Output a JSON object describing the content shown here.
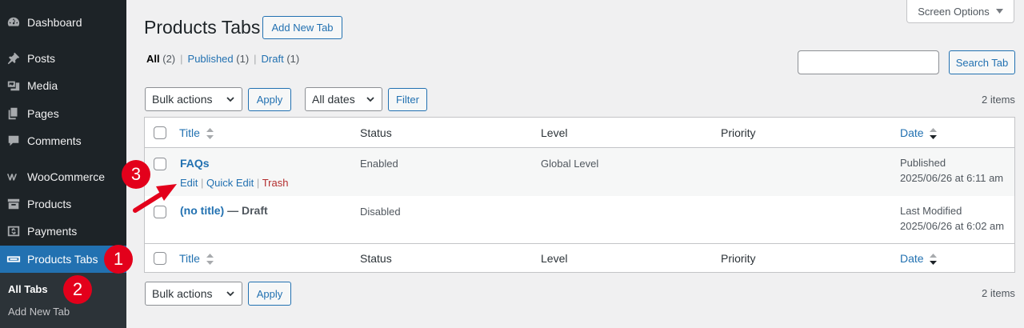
{
  "sidebar": {
    "items": [
      {
        "label": "Dashboard",
        "icon": "dashboard-icon"
      },
      {
        "label": "Posts",
        "icon": "pin-icon"
      },
      {
        "label": "Media",
        "icon": "media-icon"
      },
      {
        "label": "Pages",
        "icon": "pages-icon"
      },
      {
        "label": "Comments",
        "icon": "comments-icon"
      },
      {
        "label": "WooCommerce",
        "icon": "woocommerce-icon"
      },
      {
        "label": "Products",
        "icon": "archive-icon"
      },
      {
        "label": "Payments",
        "icon": "dollar-icon"
      },
      {
        "label": "Products Tabs",
        "icon": "tabs-icon"
      }
    ],
    "submenu": [
      {
        "label": "All Tabs"
      },
      {
        "label": "Add New Tab"
      }
    ]
  },
  "header": {
    "title": "Products Tabs",
    "add_new_label": "Add New Tab",
    "screen_options_label": "Screen Options"
  },
  "views": {
    "all_label": "All",
    "all_count": "(2)",
    "published_label": "Published",
    "published_count": "(1)",
    "draft_label": "Draft",
    "draft_count": "(1)",
    "separator": "|"
  },
  "search": {
    "value": "",
    "button_label": "Search Tab"
  },
  "toolbar": {
    "bulk_actions": "Bulk actions",
    "apply": "Apply",
    "dates": "All dates",
    "filter": "Filter",
    "items_count": "2 items"
  },
  "table": {
    "columns": {
      "title": "Title",
      "status": "Status",
      "level": "Level",
      "priority": "Priority",
      "date": "Date"
    },
    "rows": [
      {
        "title": "FAQs",
        "status": "Enabled",
        "level": "Global Level",
        "priority": "",
        "date_state": "Published",
        "date_value": "2025/06/26 at 6:11 am",
        "actions": {
          "edit": "Edit",
          "quick_edit": "Quick Edit",
          "trash": "Trash",
          "sep": "|"
        }
      },
      {
        "title": "(no title)",
        "post_state": "— Draft",
        "status": "Disabled",
        "level": "",
        "priority": "",
        "date_state": "Last Modified",
        "date_value": "2025/06/26 at 6:02 am"
      }
    ]
  },
  "annotations": {
    "badge1": "1",
    "badge2": "2",
    "badge3": "3",
    "color": "#e3001b"
  },
  "colors": {
    "sidebar_bg": "#1d2327",
    "active": "#2271b1",
    "link": "#2271b1",
    "trash": "#b32d2e"
  }
}
